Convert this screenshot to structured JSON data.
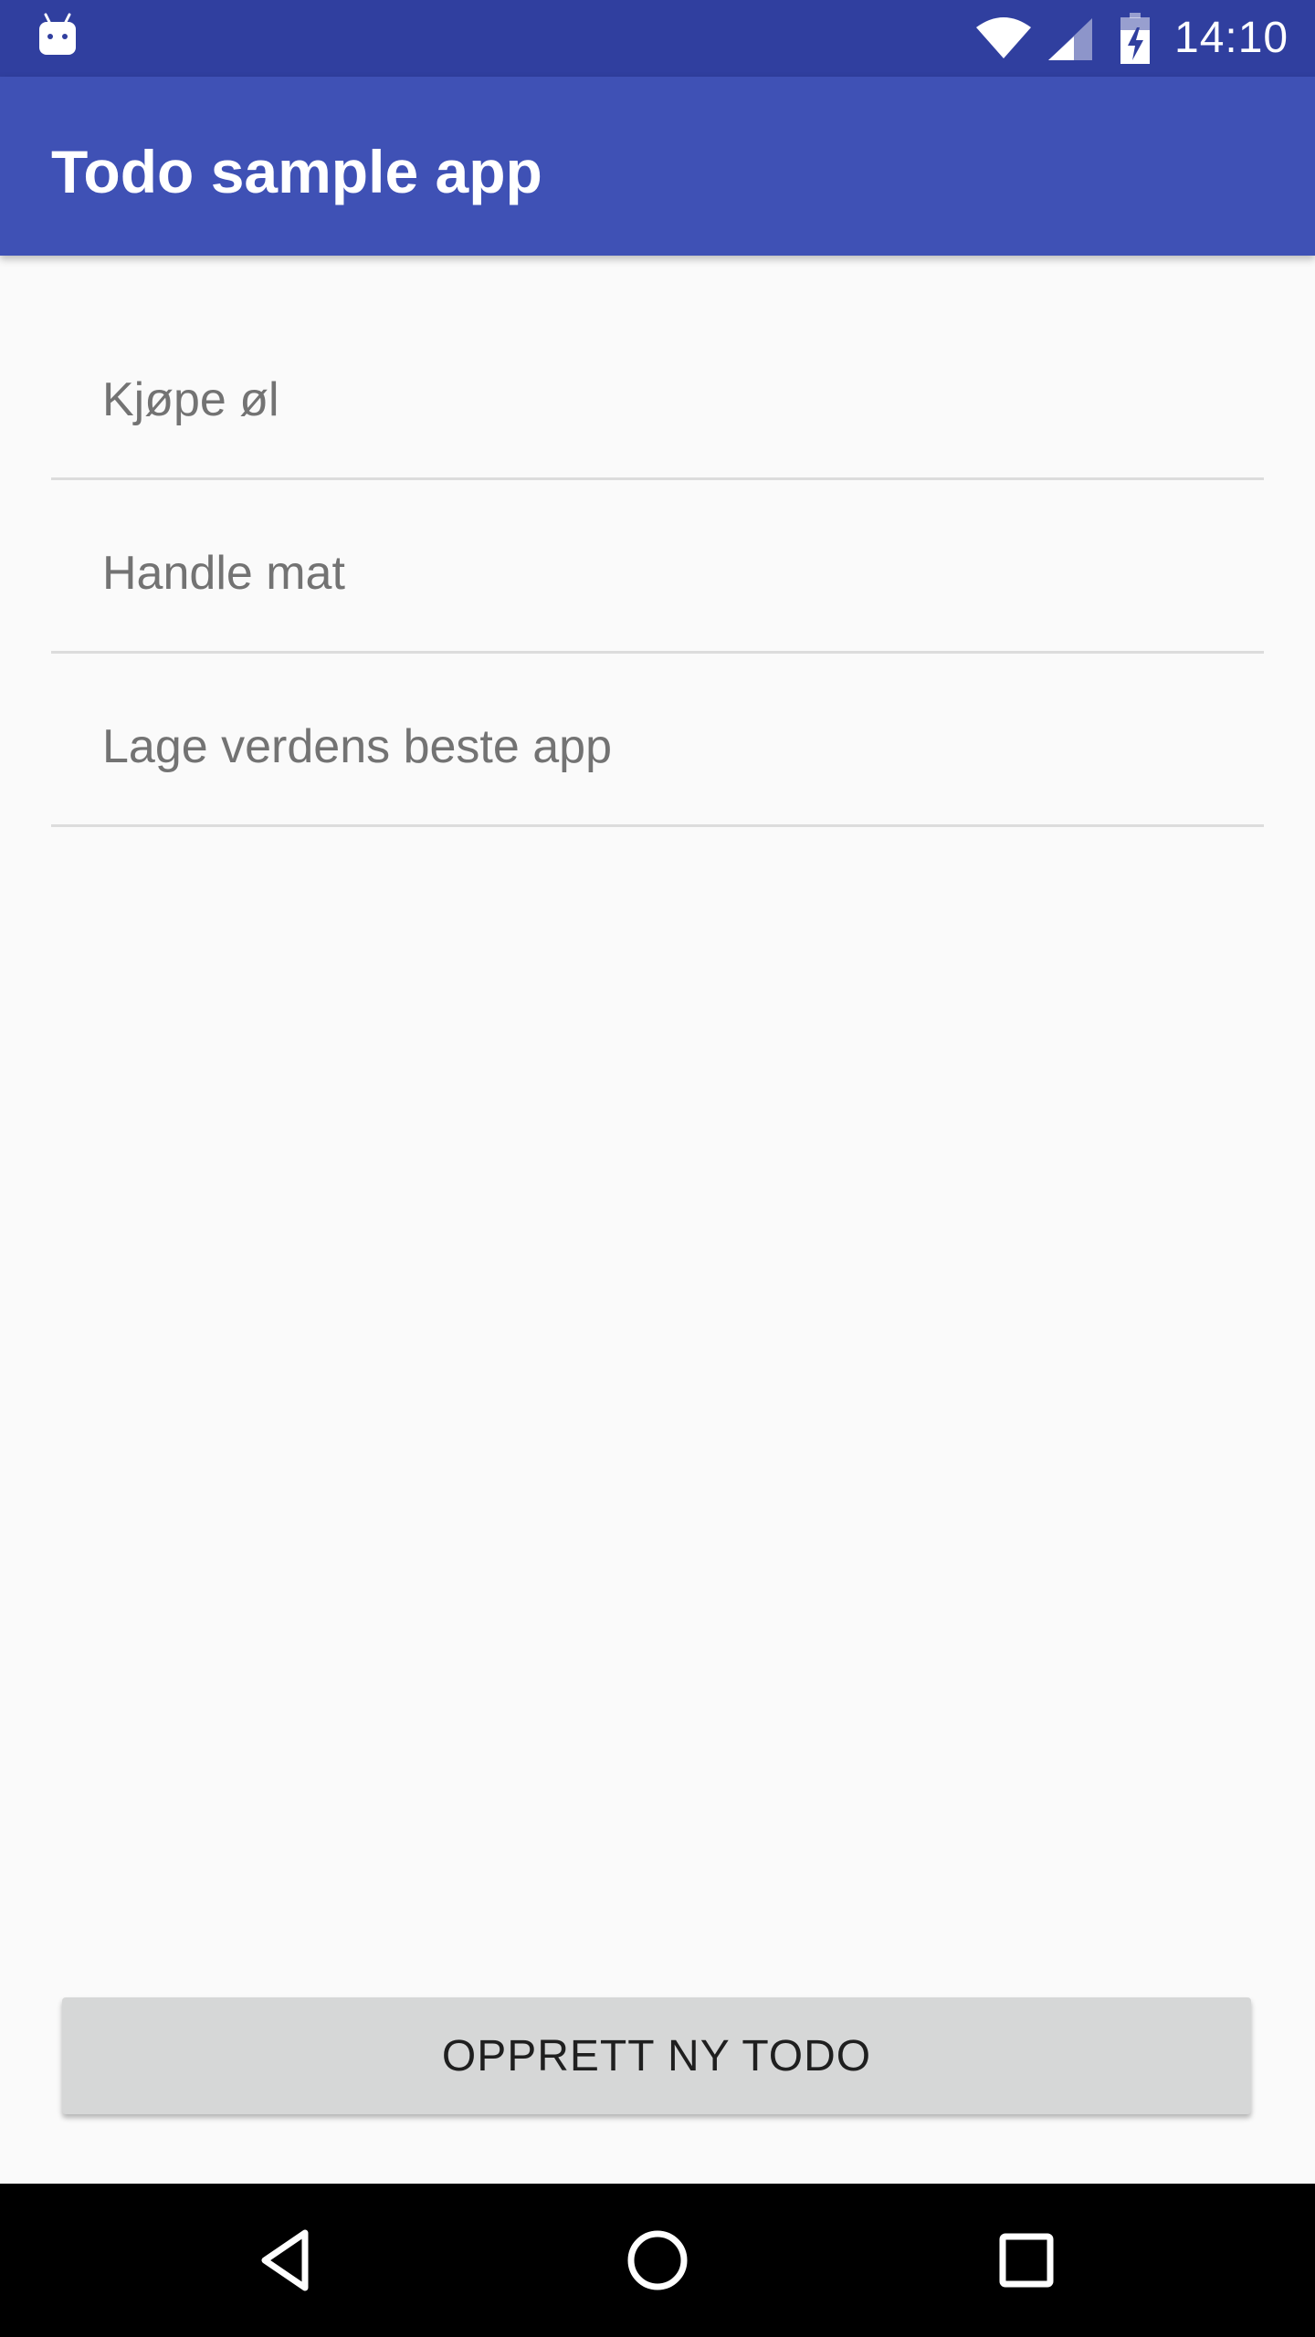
{
  "status_bar": {
    "time": "14:10",
    "icons": [
      "android-icon",
      "wifi-icon",
      "signal-icon",
      "battery-charging-icon"
    ]
  },
  "app_bar": {
    "title": "Todo sample app"
  },
  "todos": [
    {
      "label": "Kjøpe øl"
    },
    {
      "label": "Handle mat"
    },
    {
      "label": "Lage verdens beste app"
    }
  ],
  "actions": {
    "create_label": "OPPRETT NY TODO"
  },
  "nav_bar": {
    "icons": [
      "back-icon",
      "home-icon",
      "recents-icon"
    ]
  },
  "colors": {
    "status_bar": "#303f9f",
    "app_bar": "#3f51b5",
    "background": "#fafafa",
    "button": "#d6d7d7",
    "item_text": "#737373",
    "divider": "#dcdcdc"
  }
}
